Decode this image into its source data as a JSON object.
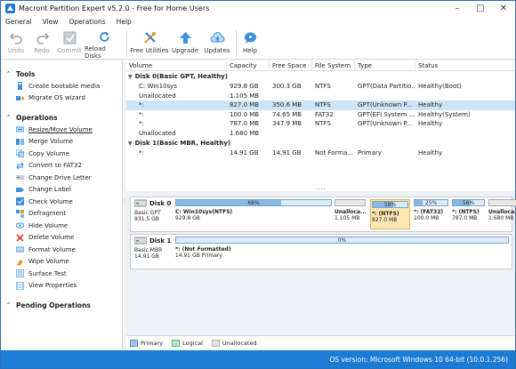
{
  "window": {
    "title": "Macront Partition Expert v5.2.0 - Free for Home Users"
  },
  "menu": [
    {
      "label": "General"
    },
    {
      "label": "View"
    },
    {
      "label": "Operations"
    },
    {
      "label": "Help"
    }
  ],
  "toolbar": {
    "undo": "Undo",
    "redo": "Redo",
    "commit": "Commit",
    "reload": "Reload Disks",
    "free_utilities": "Free Utilities",
    "upgrade": "Upgrade",
    "updates": "Updates",
    "help": "Help"
  },
  "sidebar": {
    "tools_title": "Tools",
    "tools": [
      {
        "label": "Create bootable media"
      },
      {
        "label": "Migrate OS wizard"
      }
    ],
    "operations_title": "Operations",
    "operations": [
      {
        "label": "Resize/Move Volume"
      },
      {
        "label": "Merge Volume"
      },
      {
        "label": "Copy Volume"
      },
      {
        "label": "Convert to FAT32"
      },
      {
        "label": "Change Drive Letter"
      },
      {
        "label": "Change Label"
      },
      {
        "label": "Check Volume"
      },
      {
        "label": "Defragment"
      },
      {
        "label": "Hide Volume"
      },
      {
        "label": "Delete Volume"
      },
      {
        "label": "Format Volume"
      },
      {
        "label": "Wipe Volume"
      },
      {
        "label": "Surface Test"
      },
      {
        "label": "View Properties"
      }
    ],
    "pending_title": "Pending Operations"
  },
  "table": {
    "headers": [
      "Volume",
      "Capacity",
      "Free Space",
      "File System",
      "Type",
      "Status"
    ],
    "disk0_label": "Disk 0(Basic GPT, Healthy)",
    "disk0_rows": [
      [
        "C: Win10sys",
        "929.8 GB",
        "300.3 GB",
        "NTFS",
        "GPT(Data Partitio...",
        "Healthy(Boot)"
      ],
      [
        "Unallocated",
        "1.105 MB",
        "",
        "",
        "",
        ""
      ],
      [
        "*:",
        "827.0 MB",
        "350.6 MB",
        "NTFS",
        "GPT(Unknown P...",
        "Healthy"
      ],
      [
        "*:",
        "100.0 MB",
        "74.65 MB",
        "FAT32",
        "GPT(EFI System ...",
        "Healthy(System)"
      ],
      [
        "*:",
        "787.0 MB",
        "347.9 MB",
        "NTFS",
        "GPT(Unknown P...",
        "Healthy"
      ],
      [
        "Unallocated",
        "1.680 MB",
        "",
        "",
        "",
        ""
      ]
    ],
    "disk1_label": "Disk 1(Basic MBR, Healthy)",
    "disk1_rows": [
      [
        "*:",
        "14.91 GB",
        "14.91 GB",
        "Not Forma...",
        "Primary",
        "Healthy"
      ]
    ],
    "selected_row": 2
  },
  "diskmap": {
    "disk0": {
      "name": "Disk 0",
      "type": "Basic GPT",
      "size": "931.5 GB",
      "parts": [
        {
          "pct": "68%",
          "fill": 0.68,
          "l1": "C: Win10sys(NTFS)",
          "l2": "929.8 GB"
        },
        {
          "pct": "",
          "fill": 0,
          "l1": "Unalloca...",
          "l2": "1.105 MB"
        },
        {
          "pct": "58%",
          "fill": 0.58,
          "l1": "*: (NTFS)",
          "l2": "827.0 MB"
        },
        {
          "pct": "25%",
          "fill": 0.25,
          "l1": "*: (FAT32)",
          "l2": "100.0 MB"
        },
        {
          "pct": "56%",
          "fill": 0.56,
          "l1": "*: (NTFS)",
          "l2": "787.0 MB"
        },
        {
          "pct": "",
          "fill": 0,
          "l1": "Unalloca...",
          "l2": "1.680 MB"
        }
      ]
    },
    "disk1": {
      "name": "Disk 1",
      "type": "Basic MBR",
      "size": "14.91 GB",
      "parts": [
        {
          "pct": "0%",
          "fill": 0,
          "l1": "*: (Not Formatted)",
          "l2": "14.91 GB Primary"
        }
      ]
    }
  },
  "legend": [
    "Primary",
    "Logical",
    "Unallocated"
  ],
  "status": "OS version: Microsoft Windows 10  64-bit  (10.0.1.256)",
  "colors": {
    "accent": "#1c7bd4",
    "selected": "#cde6f7",
    "highlight": "#fde7b2"
  }
}
